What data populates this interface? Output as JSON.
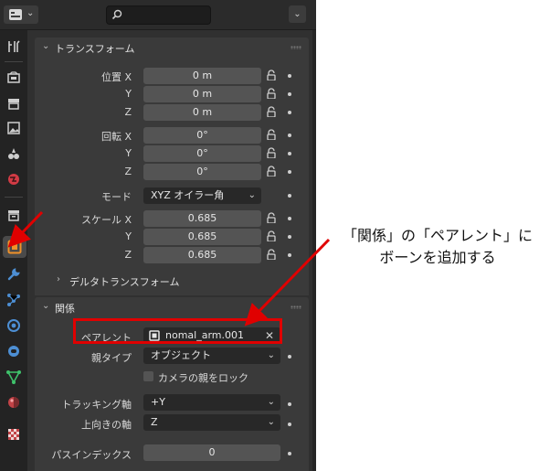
{
  "topbar": {
    "editor_icon": "properties-editor-icon",
    "search_icon": "search-icon",
    "search_placeholder": "",
    "right_chevron": "chevron-down-icon"
  },
  "tabs": [
    {
      "name": "tool-icon"
    },
    {
      "name": "render-icon"
    },
    {
      "name": "output-icon"
    },
    {
      "name": "view-layer-icon"
    },
    {
      "name": "scene-icon"
    },
    {
      "name": "world-icon"
    },
    {
      "name": "collection-icon"
    },
    {
      "name": "object-icon",
      "active": true
    },
    {
      "name": "modifier-wrench-icon"
    },
    {
      "name": "particles-icon"
    },
    {
      "name": "physics-icon"
    },
    {
      "name": "object-constraint-icon"
    },
    {
      "name": "object-data-icon"
    },
    {
      "name": "material-icon"
    },
    {
      "name": "texture-icon"
    }
  ],
  "transform": {
    "title": "トランスフォーム",
    "location_label": "位置 X",
    "location": [
      "0 m",
      "0 m",
      "0 m"
    ],
    "rotation_label": "回転 X",
    "rotation": [
      "0°",
      "0°",
      "0°"
    ],
    "axis_y": "Y",
    "axis_z": "Z",
    "mode_label": "モード",
    "mode_value": "XYZ オイラー角",
    "scale_label": "スケール X",
    "scale": [
      "0.685",
      "0.685",
      "0.685"
    ],
    "delta_title": "デルタトランスフォーム"
  },
  "relations": {
    "title": "関係",
    "parent_label": "ペアレント",
    "parent_value": "nomal_arm.001",
    "parent_type_label": "親タイプ",
    "parent_type_value": "オブジェクト",
    "lock_camera_label": "カメラの親をロック",
    "tracking_label": "トラッキング軸",
    "tracking_value": "+Y",
    "up_label": "上向きの軸",
    "up_value": "Z",
    "pass_index_label": "パスインデックス",
    "pass_index_value": "0"
  },
  "annotation": {
    "line1": "「関係」の「ペアレント」に",
    "line2": "ボーンを追加する",
    "color": "#e00000"
  }
}
